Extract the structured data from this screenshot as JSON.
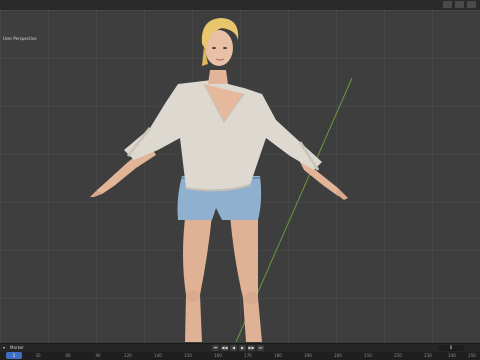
{
  "viewport": {
    "view_name": "User Perspective",
    "bg_color": "#3e3e3e"
  },
  "timeline": {
    "menu": [
      "▾",
      "Marker"
    ],
    "current_frame": "1",
    "frame_field": "0",
    "ruler_labels": [
      "1",
      "30",
      "60",
      "90",
      "120",
      "140",
      "150",
      "160",
      "170",
      "180",
      "190",
      "200",
      "210",
      "220",
      "230",
      "240",
      "250"
    ],
    "playback": [
      "⏮",
      "◀◀",
      "◀",
      "▶",
      "▶▶",
      "⏭"
    ]
  },
  "colors": {
    "sweater": "#ddd9d0",
    "shorts": "#8fb0cf",
    "skin": "#e4b89e",
    "hair": "#e8c76c",
    "grid_axis_green": "#6fa33c"
  }
}
